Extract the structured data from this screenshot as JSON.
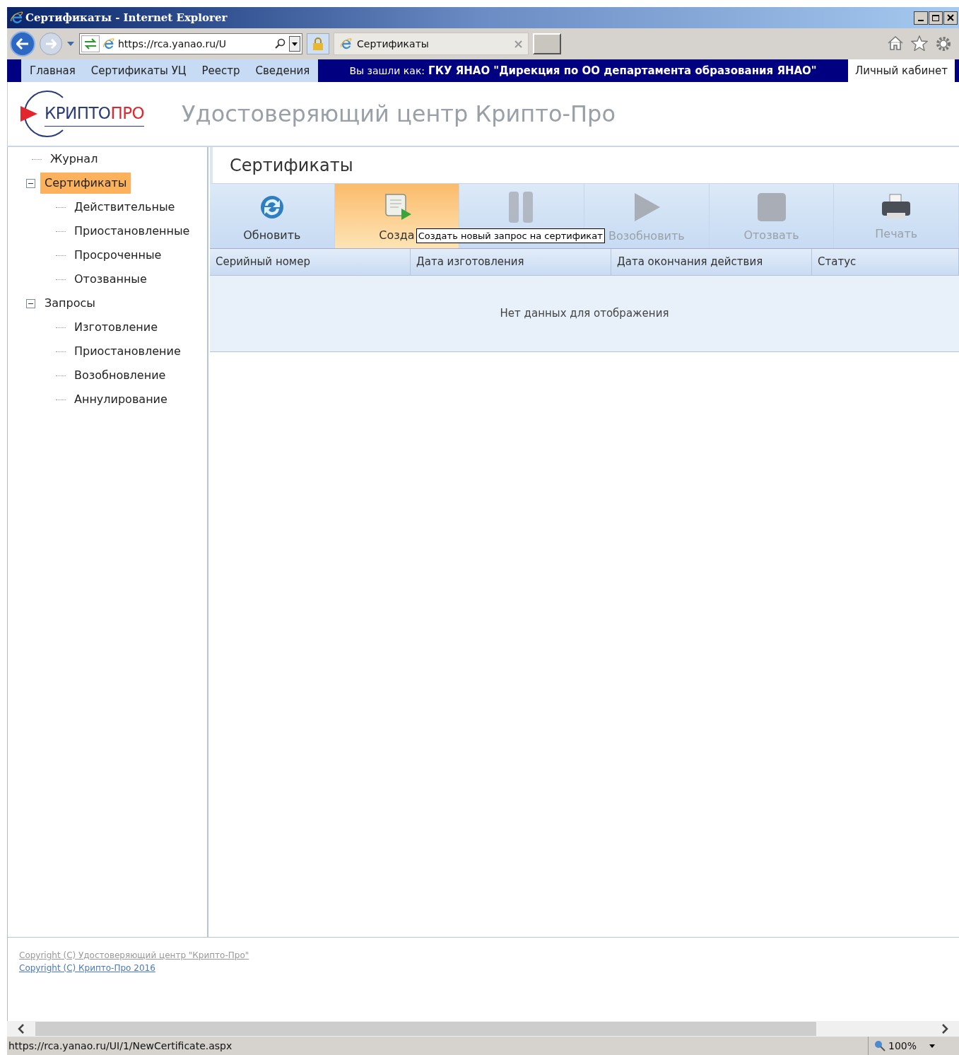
{
  "window": {
    "title": "Сертификаты - Internet Explorer"
  },
  "address_bar": {
    "value": "https://rca.yanao.ru/U"
  },
  "browser_tab": {
    "label": "Сертификаты"
  },
  "site_nav": {
    "items": [
      {
        "label": "Главная"
      },
      {
        "label": "Сертификаты УЦ"
      },
      {
        "label": "Реестр"
      },
      {
        "label": "Сведения"
      }
    ],
    "login_prefix": "Вы зашли как:",
    "login_name": "ГКУ ЯНАО \"Дирекция по ОО департамента образования ЯНАО\"",
    "cabinet": "Личный кабинет"
  },
  "header": {
    "logo_left": "КРИПТО",
    "logo_right": "ПРО",
    "title": "Удостоверяющий центр Крипто-Про"
  },
  "sidebar": {
    "items": [
      {
        "label": "Журнал",
        "selected": false
      },
      {
        "label": "Сертификаты",
        "selected": true,
        "expanded": true,
        "children": [
          {
            "label": "Действительные",
            "selected": false
          },
          {
            "label": "Приостановленные",
            "selected": false
          },
          {
            "label": "Просроченные",
            "selected": false
          },
          {
            "label": "Отозванные",
            "selected": false
          }
        ]
      },
      {
        "label": "Запросы",
        "selected": false,
        "expanded": true,
        "children": [
          {
            "label": "Изготовление",
            "selected": false
          },
          {
            "label": "Приостановление",
            "selected": false
          },
          {
            "label": "Возобновление",
            "selected": false
          },
          {
            "label": "Аннулирование",
            "selected": false
          }
        ]
      }
    ]
  },
  "panel": {
    "title": "Сертификаты",
    "toolbar": [
      {
        "kind": "refresh",
        "label": "Обновить",
        "disabled": false,
        "hovered": false
      },
      {
        "kind": "create",
        "label": "Созда",
        "disabled": false,
        "hovered": true
      },
      {
        "kind": "pause",
        "disabled": true,
        "hovered": false
      },
      {
        "kind": "play",
        "label": "Возобновить",
        "disabled": true,
        "hovered": false
      },
      {
        "kind": "stop",
        "label": "Отозвать",
        "disabled": true,
        "hovered": false
      },
      {
        "kind": "print",
        "label": "Печать",
        "disabled": true,
        "hovered": false
      }
    ],
    "tooltip": "Создать новый запрос на сертификат",
    "table": {
      "columns": [
        "Серийный номер",
        "Дата изготовления",
        "Дата окончания действия",
        "Статус"
      ],
      "empty_text": "Нет данных для отображения"
    }
  },
  "footer": {
    "links": [
      "Copyright (C) Удостоверяющий центр \"Крипто-Про\"",
      "Copyright (C) Крипто-Про 2016"
    ]
  },
  "status_bar": {
    "url": "https://rca.yanao.ru/UI/1/NewCertificate.aspx",
    "zoom": "100%"
  }
}
